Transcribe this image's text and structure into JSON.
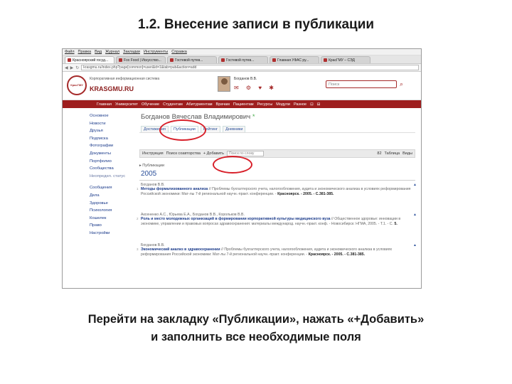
{
  "slide": {
    "title": "1.2. Внесение записи в публикации",
    "caption_line1": "Перейти на закладку «Публикации», нажать «+Добавить»",
    "caption_line2": "и заполнить все необходимые поля"
  },
  "browser": {
    "menu": [
      "Файл",
      "Правка",
      "Вид",
      "Журнал",
      "Закладки",
      "Инструменты",
      "Справка"
    ],
    "tabs": [
      {
        "label": "Красноярский госуд..."
      },
      {
        "label": "Fox Food | Искусство..."
      },
      {
        "label": "Гостевой путев..."
      },
      {
        "label": "Гостевой путев..."
      },
      {
        "label": "Главная УФАС ру..."
      },
      {
        "label": "КрасГМУ – СЭД"
      }
    ],
    "url": "krasgmu.ru/index.php?page[common]=user&id=1&tab=pub&action=add",
    "back_icon": "back-arrow-icon",
    "forward_icon": "forward-arrow-icon",
    "reload_icon": "reload-icon"
  },
  "site": {
    "org_name": "Корпоративная информационная система",
    "brand": "KRASGMU.RU",
    "logo_text": "КрасГМУ",
    "user_name": "Богданов В.В.",
    "user_icons": "✉ ⚙ ♥ ✱",
    "search_placeholder": "Поиск",
    "search_icon": "magnifier-icon",
    "accent": "#9e1e1e",
    "nav": [
      "Главная",
      "Университет",
      "Обучение",
      "Студентам",
      "Абитуриентам",
      "Врачам",
      "Пациентам",
      "Ресурсы",
      "Модули",
      "Разное",
      "⊡",
      "⊟"
    ]
  },
  "left_nav": {
    "group1": [
      "Основное",
      "Новости",
      "Друзья",
      "Подписка",
      "Фотографии",
      "Документы",
      "Портфолио",
      "Сообщества",
      "Неопредел. статус"
    ],
    "group2": [
      "Сообщения",
      "Дела",
      "Здоровье",
      "Психология",
      "Кошелек",
      "Право",
      "Настройки"
    ]
  },
  "profile": {
    "name": "Богданов Вячеслав Владимирович",
    "star": "*",
    "tabs": [
      "Достижения",
      "Публикации",
      "Рейтинг",
      "Дневники"
    ],
    "active_tab": "Публикации"
  },
  "toolbar": {
    "instruction": "Инструкция",
    "search_co": "Поиск соавторства",
    "add": "+ Добавить",
    "search_placeholder": "Поиск по слову",
    "count": "82",
    "table_btn": "Таблица",
    "views_btn": "Виды"
  },
  "publications": {
    "header": "Публикации",
    "year": "2005",
    "items": [
      {
        "num": "1",
        "authors": "Богданов В.В.",
        "title": "Методы формализованного анализа",
        "body": "// Проблемы бухгалтерского учета, налогообложения, аудита и экономического анализа в условиях реформирования Российской экономики: Мат-лы 7-й региональной научн.-практ. конференции. -",
        "tail": "Красноярск. - 2005. - С.381-385."
      },
      {
        "num": "2",
        "authors": "Аксененко А.С., Юрьева Е.А., Богданов В.В., Корольков В.В.",
        "title": "Роль и место молодежных организаций в формировании корпоративной культуры медицинского вуза",
        "body": "// Общественное здоровье: инновации в экономике, управлении и правовых вопросах здравоохранения: материалы международ. научн.-практ. конф. - Новосибирск: НГМА, 2005. - Т.1. - С.",
        "tail": "5."
      },
      {
        "num": "3",
        "authors": "Богданов В.В.",
        "title": "Экономический анализ в здравоохранении",
        "body": "// Проблемы бухгалтерского учета, налогообложения, аудита и экономического анализа в условиях реформирования Российской экономики: Мат-лы 7-й региональной научн.-практ. конференции. -",
        "tail": "Красноярск. - 2005. - С.381-385."
      }
    ]
  },
  "highlight_color": "#d8202a"
}
